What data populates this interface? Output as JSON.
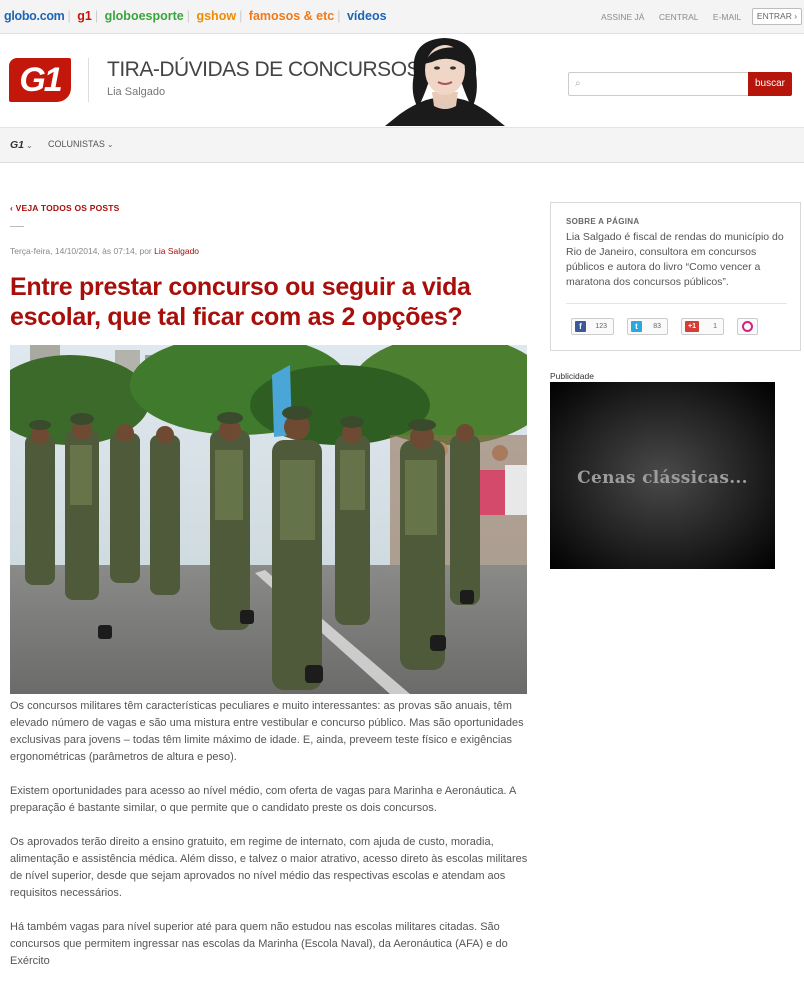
{
  "globalbar": {
    "brands": [
      "globo.com",
      "g1",
      "globoesporte",
      "gshow",
      "famosos & etc",
      "vídeos"
    ],
    "links": [
      "ASSINE JÁ",
      "CENTRAL",
      "E-MAIL"
    ],
    "email_chevron": "⌄",
    "login": "ENTRAR ›"
  },
  "header": {
    "logo": "G1",
    "blog_title": "TIRA-DÚVIDAS DE CONCURSOS",
    "author": "Lia Salgado",
    "search_placeholder": "",
    "search_button": "buscar"
  },
  "nav": {
    "g1": "G1",
    "colunistas": "COLUNISTAS"
  },
  "post": {
    "back_link": "‹ VEJA TODOS OS POSTS",
    "meta_prefix": "Terça-feira, 14/10/2014, às 07:14, por ",
    "meta_author": "Lia Salgado",
    "title": "Entre prestar concurso ou seguir a vida escolar, que tal ficar com as 2 opções?",
    "paragraphs": [
      "Os concursos militares têm características peculiares e muito interessantes: as provas são anuais, têm elevado número de vagas e são uma mistura entre vestibular e concurso público. Mas são oportunidades exclusivas para jovens – todas têm limite máximo de idade. E, ainda, preveem teste físico e exigências ergonométricas (parâmetros de altura e peso).",
      "Existem oportunidades para acesso ao nível médio, com oferta de vagas para Marinha e Aeronáutica. A preparação é bastante similar, o que permite que o candidato preste os dois concursos.",
      "Os aprovados terão direito a ensino gratuito, em regime de internato, com ajuda de custo, moradia, alimentação e assistência médica. Além disso, e talvez o maior atrativo, acesso direto às escolas militares de nível superior, desde que sejam aprovados no nível médio das respectivas escolas e atendam aos requisitos necessários.",
      "Há também vagas para nível superior até para quem não estudou nas escolas militares citadas. São concursos que permitem ingressar nas escolas da Marinha (Escola Naval), da Aeronáutica (AFA) e do Exército"
    ]
  },
  "sidebar": {
    "about_heading": "SOBRE A PÁGINA",
    "about_text": "Lia Salgado é fiscal de rendas do município do Rio de Janeiro, consultora em concursos públicos e autora do livro “Como vencer a maratona dos concursos públicos”.",
    "share": [
      {
        "icon": "facebook-icon",
        "glyph": "f",
        "count": "123",
        "color": "#3b5998"
      },
      {
        "icon": "twitter-icon",
        "glyph": "t",
        "count": "83",
        "color": "#2aa9e0"
      },
      {
        "icon": "google-plus-icon",
        "glyph": "+1",
        "count": "1",
        "color": "#d73d32"
      }
    ],
    "publicidade": "Publicidade",
    "ad_text": "Cenas clássicas..."
  }
}
